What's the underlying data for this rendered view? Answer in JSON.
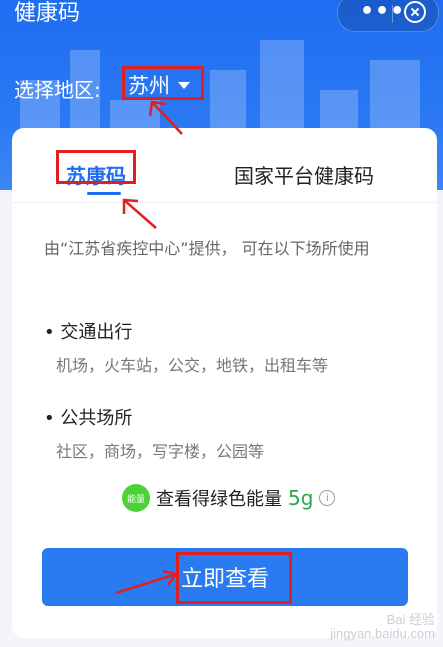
{
  "header": {
    "title": "健康码",
    "more_label": "•••",
    "region_label": "选择地区:",
    "region_value": "苏州"
  },
  "tabs": [
    {
      "label": "苏康码",
      "active": true
    },
    {
      "label": "国家平台健康码",
      "active": false
    }
  ],
  "card": {
    "description": "由“江苏省疾控中心”提供， 可在以下场所使用",
    "sections": [
      {
        "title": "• 交通出行",
        "items": "机场，火车站，公交，地铁，出租车等"
      },
      {
        "title": "• 公共场所",
        "items": "社区，商场，写字楼，公园等"
      }
    ],
    "energy": {
      "badge": "能量",
      "text": "查看得绿色能量",
      "amount": "5g",
      "info": "i"
    },
    "button_label": "立即查看"
  },
  "watermark": {
    "line1": "Bai 经验",
    "line2": "jingyan.baidu.com"
  },
  "colors": {
    "primary": "#1f6df1",
    "button": "#2a7bf0",
    "annotation": "#e02020",
    "energy": "#29a84a"
  }
}
